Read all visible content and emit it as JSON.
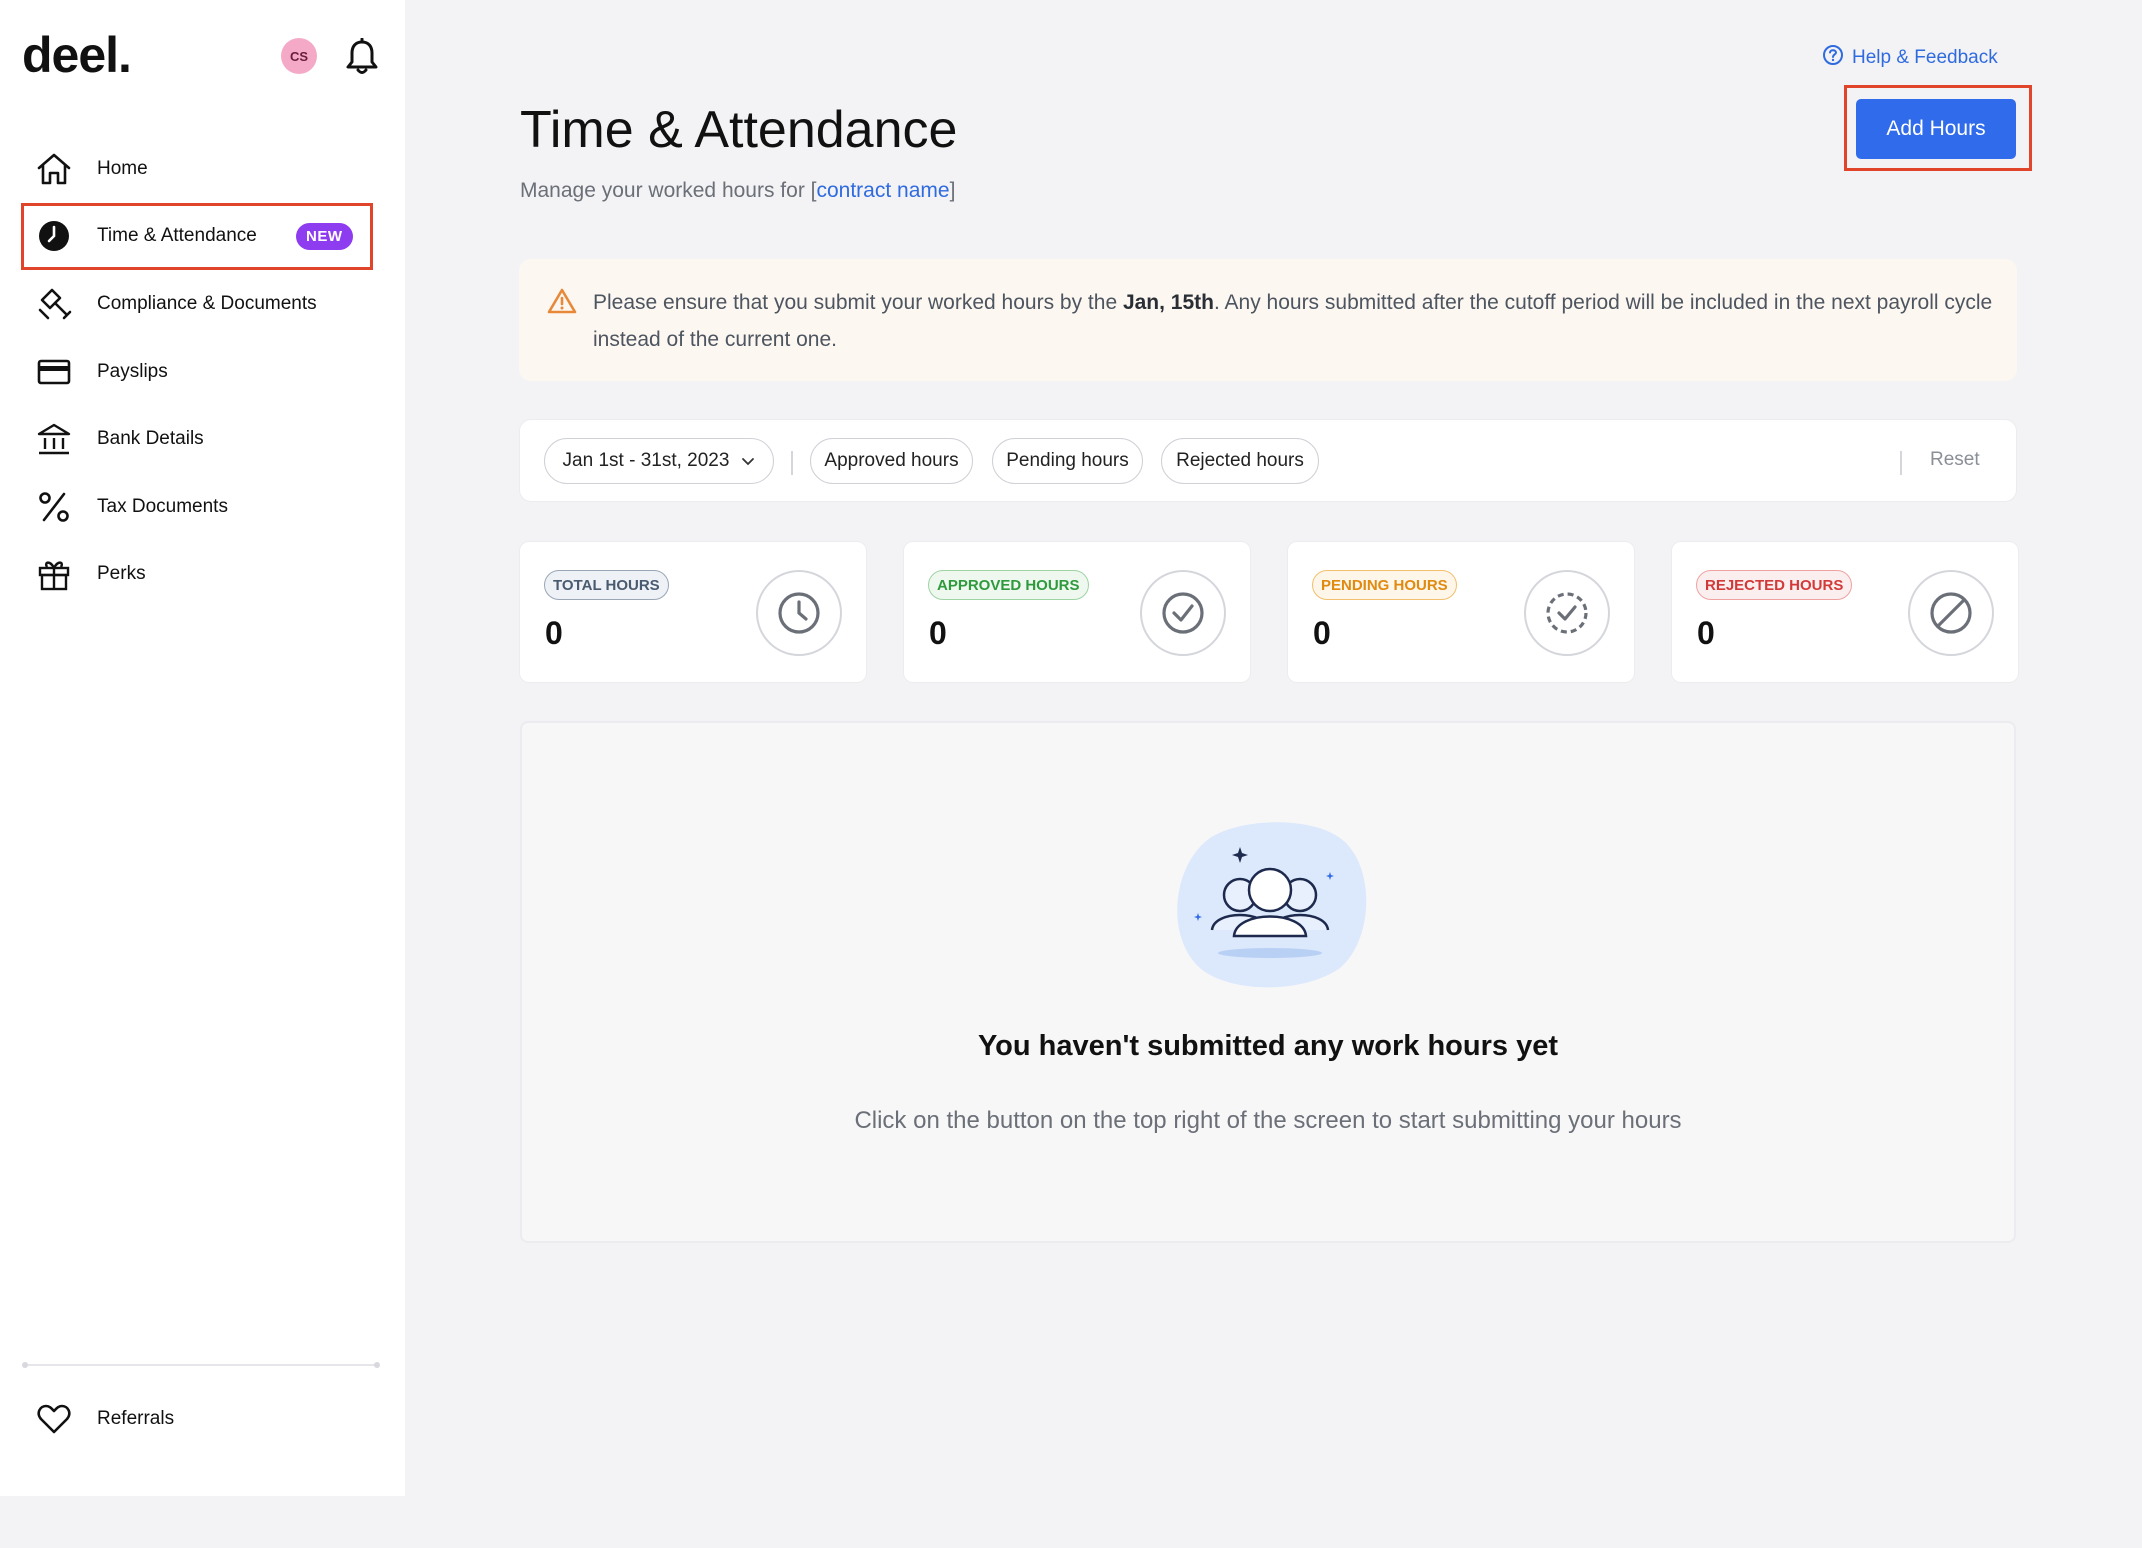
{
  "app": {
    "logo": "deel.",
    "avatar_initials": "CS"
  },
  "sidebar": {
    "items": [
      {
        "label": "Home",
        "icon": "home-icon"
      },
      {
        "label": "Time & Attendance",
        "icon": "clock-icon",
        "badge": "NEW",
        "active": true
      },
      {
        "label": "Compliance & Documents",
        "icon": "gavel-icon"
      },
      {
        "label": "Payslips",
        "icon": "credit-card-icon"
      },
      {
        "label": "Bank Details",
        "icon": "bank-icon"
      },
      {
        "label": "Tax Documents",
        "icon": "percent-icon"
      },
      {
        "label": "Perks",
        "icon": "gift-icon"
      }
    ],
    "referrals_label": "Referrals"
  },
  "header": {
    "help_label": "Help & Feedback",
    "title": "Time & Attendance",
    "subtitle_prefix": "Manage your worked hours for [",
    "subtitle_link": "contract name",
    "subtitle_suffix": "]",
    "add_button": "Add Hours"
  },
  "alert": {
    "text_before": "Please ensure that you submit your worked hours by the ",
    "text_bold": "Jan, 15th",
    "text_after": ". Any hours submitted after the cutoff period will be included in the next payroll cycle instead of the current one."
  },
  "filters": {
    "date_range": "Jan 1st - 31st, 2023",
    "chips": [
      "Approved hours",
      "Pending hours",
      "Rejected hours"
    ],
    "reset": "Reset"
  },
  "stats": [
    {
      "label": "TOTAL HOURS",
      "value": "0",
      "color": "#4a5a70",
      "bg": "#eef1f6",
      "icon": "clock-icon"
    },
    {
      "label": "APPROVED HOURS",
      "value": "0",
      "color": "#2f9a3d",
      "bg": "#eef8ef",
      "icon": "check-circle-icon"
    },
    {
      "label": "PENDING HOURS",
      "value": "0",
      "color": "#e08a10",
      "bg": "#fdf6e9",
      "icon": "pending-check-icon"
    },
    {
      "label": "REJECTED HOURS",
      "value": "0",
      "color": "#d23a3a",
      "bg": "#fbeeee",
      "icon": "ban-icon"
    }
  ],
  "empty_state": {
    "title": "You haven't submitted any work hours yet",
    "description": "Click on the button on the top right of the screen to start submitting your hours"
  },
  "colors": {
    "accent": "#2f6bea",
    "highlight": "#e0442b",
    "badge": "#8e3cf0"
  }
}
